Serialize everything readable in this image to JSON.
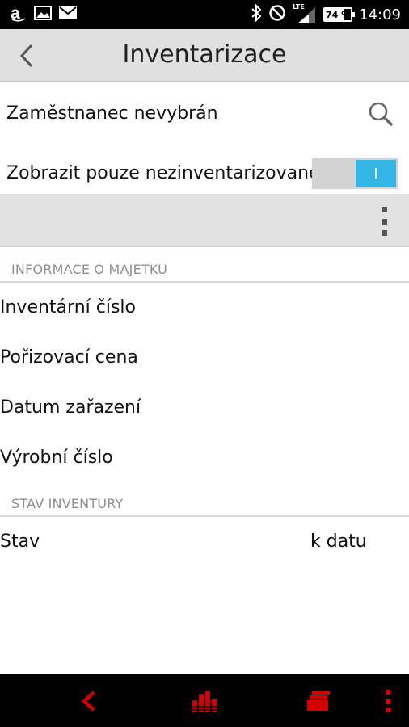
{
  "statusbar": {
    "time": "14:09",
    "battery_percent": "74 %",
    "battery_level": 0.74,
    "network_label": "LTE",
    "icons": [
      "amazon-icon",
      "image-icon",
      "mail-icon",
      "bluetooth-icon",
      "do-not-disturb-icon",
      "signal-icon",
      "battery-icon"
    ]
  },
  "appbar": {
    "title": "Inventarizace",
    "back_icon": "chevron-left-icon"
  },
  "employee": {
    "label": "Zaměstnanec nevybrán",
    "search_icon": "search-icon"
  },
  "filter": {
    "label": "Zobrazit pouze nezinventarizované",
    "toggle_state": "I",
    "toggle_on": true
  },
  "toolbar": {
    "overflow_icon": "more-vert-icon"
  },
  "asset_section": {
    "header": "INFORMACE O MAJETKU",
    "fields": [
      "Inventární číslo",
      "Pořizovací cena",
      "Datum zařazení",
      "Výrobní číslo"
    ]
  },
  "inventory_section": {
    "header": "STAV INVENTURY",
    "status_label": "Stav",
    "date_label": "k datu"
  },
  "navbar": {
    "icons": [
      "back-icon",
      "statistics-icon",
      "cards-icon",
      "more-vert-icon"
    ],
    "accent_color": "#d40000"
  }
}
